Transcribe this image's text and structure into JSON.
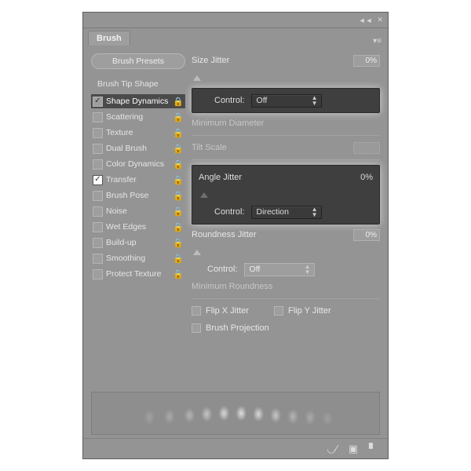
{
  "panel": {
    "title": "Brush"
  },
  "sidebar": {
    "presets_label": "Brush Presets",
    "tip_shape_label": "Brush Tip Shape",
    "items": [
      {
        "label": "Shape Dynamics",
        "checked": true,
        "locked": true,
        "selected": true
      },
      {
        "label": "Scattering",
        "checked": false,
        "locked": true
      },
      {
        "label": "Texture",
        "checked": false,
        "locked": true
      },
      {
        "label": "Dual Brush",
        "checked": false,
        "locked": true
      },
      {
        "label": "Color Dynamics",
        "checked": false,
        "locked": true
      },
      {
        "label": "Transfer",
        "checked": true,
        "locked": true,
        "dark": true
      },
      {
        "label": "Brush Pose",
        "checked": false,
        "locked": true
      },
      {
        "label": "Noise",
        "checked": false,
        "locked": true
      },
      {
        "label": "Wet Edges",
        "checked": false,
        "locked": true
      },
      {
        "label": "Build-up",
        "checked": false,
        "locked": true
      },
      {
        "label": "Smoothing",
        "checked": false,
        "locked": true
      },
      {
        "label": "Protect Texture",
        "checked": false,
        "locked": true
      }
    ]
  },
  "main": {
    "size_jitter_label": "Size Jitter",
    "size_jitter_value": "0%",
    "control_label": "Control:",
    "size_control_value": "Off",
    "min_diameter_label": "Minimum Diameter",
    "tilt_scale_label": "Tilt Scale",
    "angle_jitter_label": "Angle Jitter",
    "angle_jitter_value": "0%",
    "angle_control_value": "Direction",
    "roundness_jitter_label": "Roundness Jitter",
    "roundness_jitter_value": "0%",
    "roundness_control_value": "Off",
    "min_roundness_label": "Minimum Roundness",
    "flip_x_label": "Flip X Jitter",
    "flip_y_label": "Flip Y Jitter",
    "brush_projection_label": "Brush Projection"
  }
}
